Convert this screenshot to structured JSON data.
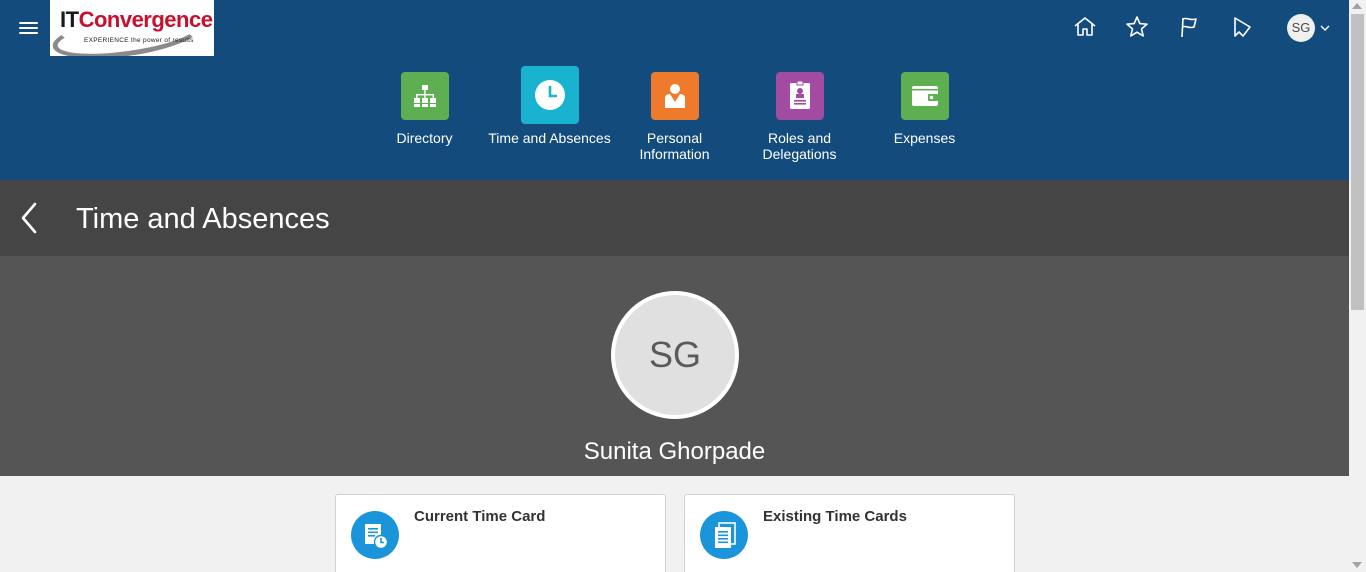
{
  "header": {
    "logo_text_it": "IT",
    "logo_text_brand": "Convergence",
    "logo_tagline": "EXPERIENCE the power of results",
    "icons": [
      "home-icon",
      "favorites-star-icon",
      "notifications-flag-icon",
      "watchlist-icon"
    ],
    "user_initials": "SG"
  },
  "nav": {
    "items": [
      {
        "label": "Directory",
        "icon": "directory-org-chart-icon",
        "color": "#5daf52"
      },
      {
        "label": "Time and Absences",
        "icon": "clock-icon",
        "color": "#19b3cf"
      },
      {
        "label": "Personal\nInformation",
        "icon": "person-badge-icon",
        "color": "#f07a2b"
      },
      {
        "label": "Roles and\nDelegations",
        "icon": "id-card-icon",
        "color": "#a34aa3"
      },
      {
        "label": "Expenses",
        "icon": "wallet-icon",
        "color": "#5daf52"
      }
    ]
  },
  "page": {
    "title": "Time and Absences"
  },
  "profile": {
    "initials": "SG",
    "name": "Sunita Ghorpade"
  },
  "cards": [
    {
      "title": "Current Time Card",
      "icon": "time-card-clock-icon"
    },
    {
      "title": "Existing Time Cards",
      "icon": "time-cards-stack-icon"
    }
  ],
  "colors": {
    "header_bg": "#124b7c",
    "title_bar_bg": "#454545",
    "profile_bg": "#555555",
    "card_icon_bg": "#1b95d9"
  }
}
